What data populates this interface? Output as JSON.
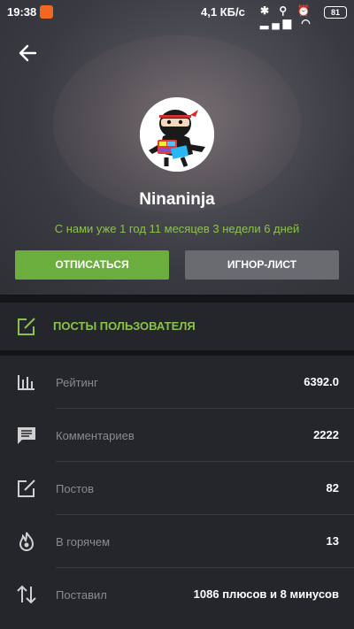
{
  "status_bar": {
    "time": "19:38",
    "speed": "4,1 КБ/с",
    "battery": "81"
  },
  "profile": {
    "username": "Ninaninja",
    "since": "С нами уже 1 год 11 месяцев 3 недели 6 дней",
    "unsubscribe_label": "ОТПИСАТЬСЯ",
    "ignore_label": "ИГНОР-ЛИСТ"
  },
  "posts_link": {
    "label": "ПОСТЫ ПОЛЬЗОВАТЕЛЯ",
    "icon": "edit-icon"
  },
  "stats": [
    {
      "label": "Рейтинг",
      "value": "6392.0",
      "icon": "bar-chart-icon"
    },
    {
      "label": "Комментариев",
      "value": "2222",
      "icon": "comment-icon"
    },
    {
      "label": "Постов",
      "value": "82",
      "icon": "edit-icon"
    },
    {
      "label": "В горячем",
      "value": "13",
      "icon": "flame-icon"
    },
    {
      "label": "Поставил",
      "value": "1086 плюсов и 8 минусов",
      "icon": "swap-vertical-icon"
    }
  ],
  "colors": {
    "accent": "#8bc34a",
    "button_green": "#6cae3e",
    "button_gray": "#6a6b70",
    "panel": "#25262b"
  }
}
